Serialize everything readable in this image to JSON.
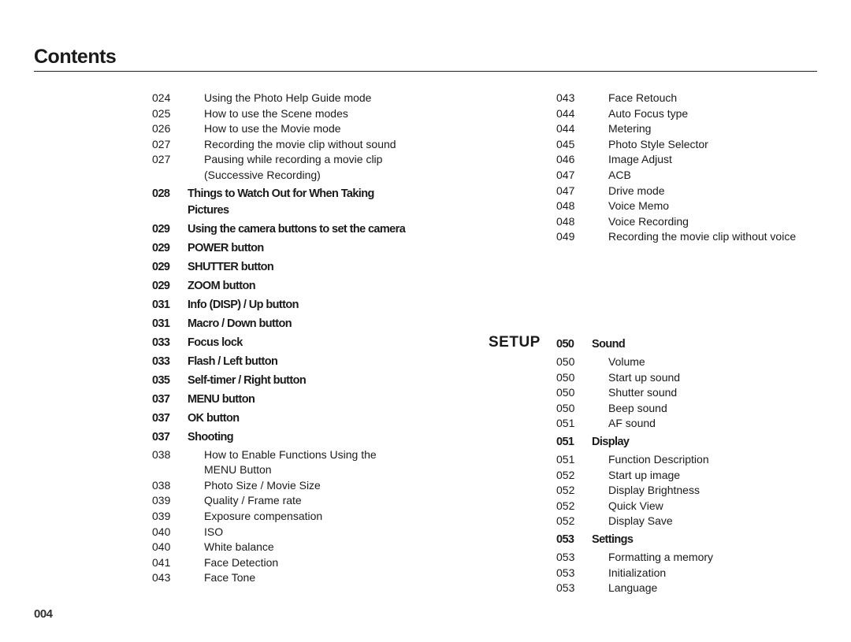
{
  "title": "Contents",
  "page_number": "004",
  "left_column": [
    {
      "page": "024",
      "text": "Using the Photo Help Guide mode",
      "level": "sub"
    },
    {
      "page": "025",
      "text": "How to use the Scene modes",
      "level": "sub"
    },
    {
      "page": "026",
      "text": "How to use the Movie mode",
      "level": "sub"
    },
    {
      "page": "027",
      "text": "Recording the movie clip without sound",
      "level": "sub"
    },
    {
      "page": "027",
      "text": "Pausing while recording a movie clip",
      "level": "sub"
    },
    {
      "page": "",
      "text": "(Successive Recording)",
      "level": "sub"
    },
    {
      "page": "028",
      "text": "Things to Watch Out for When Taking",
      "level": "main"
    },
    {
      "page": "",
      "text": "Pictures",
      "level": "main-cont"
    },
    {
      "page": "029",
      "text": "Using the camera buttons to set the camera",
      "level": "main"
    },
    {
      "page": "029",
      "text": "POWER button",
      "level": "main"
    },
    {
      "page": "029",
      "text": "SHUTTER button",
      "level": "main"
    },
    {
      "page": "029",
      "text": "ZOOM button",
      "level": "main"
    },
    {
      "page": "031",
      "text": "Info (DISP) / Up button",
      "level": "main"
    },
    {
      "page": "031",
      "text": "Macro / Down button",
      "level": "main"
    },
    {
      "page": "033",
      "text": "Focus lock",
      "level": "main"
    },
    {
      "page": "033",
      "text": "Flash / Left button",
      "level": "main"
    },
    {
      "page": "035",
      "text": "Self-timer / Right button",
      "level": "main"
    },
    {
      "page": "037",
      "text": "MENU button",
      "level": "main"
    },
    {
      "page": "037",
      "text": "OK button",
      "level": "main"
    },
    {
      "page": "037",
      "text": "Shooting",
      "level": "main"
    },
    {
      "page": "038",
      "text": "How to Enable Functions Using the",
      "level": "sub"
    },
    {
      "page": "",
      "text": "MENU Button",
      "level": "sub"
    },
    {
      "page": "038",
      "text": "Photo Size / Movie Size",
      "level": "sub"
    },
    {
      "page": "039",
      "text": "Quality / Frame rate",
      "level": "sub"
    },
    {
      "page": "039",
      "text": "Exposure compensation",
      "level": "sub"
    },
    {
      "page": "040",
      "text": "ISO",
      "level": "sub"
    },
    {
      "page": "040",
      "text": "White balance",
      "level": "sub"
    },
    {
      "page": "041",
      "text": "Face Detection",
      "level": "sub"
    },
    {
      "page": "043",
      "text": "Face Tone",
      "level": "sub"
    }
  ],
  "right_column_top": [
    {
      "page": "043",
      "text": "Face Retouch",
      "level": "sub"
    },
    {
      "page": "044",
      "text": "Auto Focus type",
      "level": "sub"
    },
    {
      "page": "044",
      "text": "Metering",
      "level": "sub"
    },
    {
      "page": "045",
      "text": "Photo Style Selector",
      "level": "sub"
    },
    {
      "page": "046",
      "text": "Image Adjust",
      "level": "sub"
    },
    {
      "page": "047",
      "text": "ACB",
      "level": "sub"
    },
    {
      "page": "047",
      "text": "Drive mode",
      "level": "sub"
    },
    {
      "page": "048",
      "text": "Voice Memo",
      "level": "sub"
    },
    {
      "page": "048",
      "text": "Voice Recording",
      "level": "sub"
    },
    {
      "page": "049",
      "text": "Recording the movie clip without voice",
      "level": "sub"
    }
  ],
  "setup_section": {
    "label": "SETUP",
    "entries": [
      {
        "page": "050",
        "text": "Sound",
        "level": "main"
      },
      {
        "page": "050",
        "text": "Volume",
        "level": "sub"
      },
      {
        "page": "050",
        "text": "Start up sound",
        "level": "sub"
      },
      {
        "page": "050",
        "text": "Shutter sound",
        "level": "sub"
      },
      {
        "page": "050",
        "text": "Beep sound",
        "level": "sub"
      },
      {
        "page": "051",
        "text": "AF sound",
        "level": "sub"
      },
      {
        "page": "051",
        "text": "Display",
        "level": "main"
      },
      {
        "page": "051",
        "text": "Function Description",
        "level": "sub"
      },
      {
        "page": "052",
        "text": "Start up image",
        "level": "sub"
      },
      {
        "page": "052",
        "text": "Display Brightness",
        "level": "sub"
      },
      {
        "page": "052",
        "text": "Quick View",
        "level": "sub"
      },
      {
        "page": "052",
        "text": "Display Save",
        "level": "sub"
      },
      {
        "page": "053",
        "text": "Settings",
        "level": "main"
      },
      {
        "page": "053",
        "text": "Formatting a memory",
        "level": "sub"
      },
      {
        "page": "053",
        "text": "Initialization",
        "level": "sub"
      },
      {
        "page": "053",
        "text": "Language",
        "level": "sub"
      }
    ]
  }
}
